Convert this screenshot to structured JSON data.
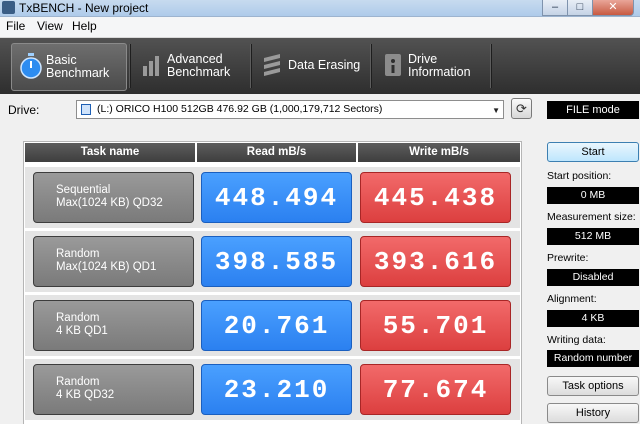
{
  "window": {
    "title": "TxBENCH - New project",
    "minimize": "–",
    "maximize": "□",
    "close": "✕"
  },
  "menu": [
    "File",
    "View",
    "Help"
  ],
  "toolbar": {
    "tabs": [
      {
        "label": "Basic\nBenchmark",
        "icon": "stopwatch-icon",
        "active": true
      },
      {
        "label": "Advanced\nBenchmark",
        "icon": "bar-chart-icon",
        "active": false
      },
      {
        "label": "Data Erasing",
        "icon": "eraser-icon",
        "active": false
      },
      {
        "label": "Drive\nInformation",
        "icon": "drive-info-icon",
        "active": false
      }
    ]
  },
  "drive": {
    "label": "Drive:",
    "selected": "(L:) ORICO H100 512GB  476.92 GB (1,000,179,712 Sectors)",
    "mode": "FILE mode"
  },
  "table": {
    "headers": {
      "task": "Task name",
      "read": "Read mB/s",
      "write": "Write mB/s"
    },
    "rows": [
      {
        "task": "Sequential\nMax(1024 KB) QD32",
        "read": "448.494",
        "write": "445.438"
      },
      {
        "task": "Random\nMax(1024 KB) QD1",
        "read": "398.585",
        "write": "393.616"
      },
      {
        "task": "Random\n4 KB QD1",
        "read": "20.761",
        "write": "55.701"
      },
      {
        "task": "Random\n4 KB QD32",
        "read": "23.210",
        "write": "77.674"
      }
    ]
  },
  "panel": {
    "start": "Start",
    "start_position_label": "Start position:",
    "start_position": "0 MB",
    "measurement_size_label": "Measurement size:",
    "measurement_size": "512 MB",
    "prewrite_label": "Prewrite:",
    "prewrite": "Disabled",
    "alignment_label": "Alignment:",
    "alignment": "4 KB",
    "writing_data_label": "Writing data:",
    "writing_data": "Random number",
    "task_options": "Task options",
    "history": "History"
  },
  "colors": {
    "read": "#2b80f0",
    "write": "#dc3f3f",
    "toolbar": "#3a3a3a"
  }
}
